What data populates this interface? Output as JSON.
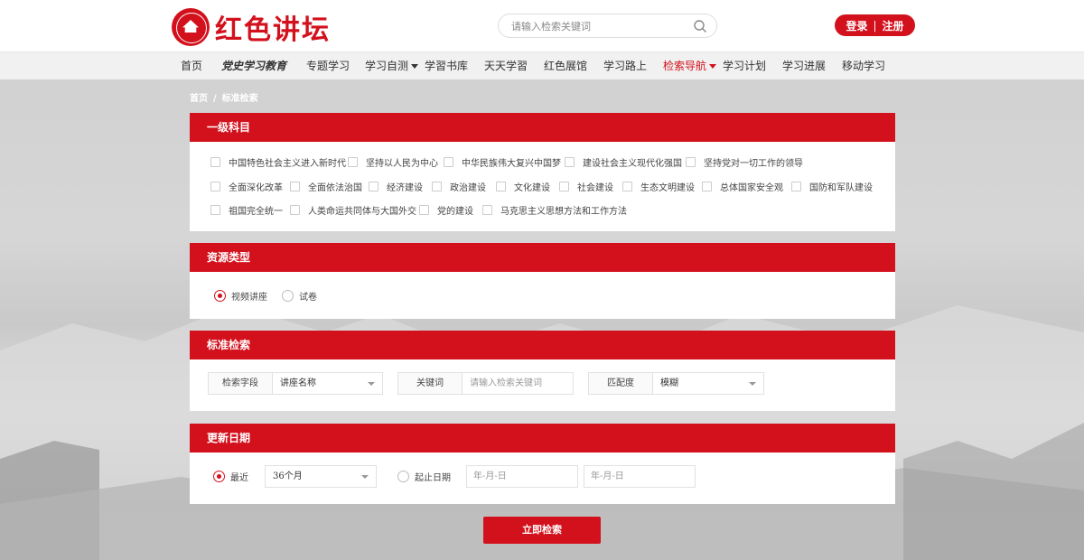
{
  "brand": {
    "name": "红色讲坛",
    "seal_icon": "party-history-seal-icon",
    "color": "#d3111d"
  },
  "search": {
    "placeholder": "请输入检索关键词",
    "icon": "search-icon"
  },
  "auth": {
    "login": "登录",
    "separator": "|",
    "register": "注册"
  },
  "nav": {
    "items": [
      {
        "label": "首页"
      },
      {
        "label": "党史学习教育"
      },
      {
        "label": "专题学习"
      },
      {
        "label": "学习自测",
        "dropdown": true
      },
      {
        "label": "学習书库"
      },
      {
        "label": "天天学習"
      },
      {
        "label": "红色展馆"
      },
      {
        "label": "学习路上"
      },
      {
        "label": "检索导航",
        "dropdown": true,
        "active": true
      },
      {
        "label": "学习计划"
      },
      {
        "label": "学习进展"
      },
      {
        "label": "移动学习"
      }
    ]
  },
  "breadcrumb": {
    "home": "首页",
    "separator": "/",
    "current": "标准检索"
  },
  "subjects": {
    "title": "一级科目",
    "rows": [
      [
        "中国特色社会主义进入新时代",
        "坚持以人民为中心",
        "中华民族伟大复兴中国梦",
        "建设社会主义现代化强国",
        "坚持党对一切工作的领导"
      ],
      [
        "全面深化改革",
        "全面依法治国",
        "经济建设",
        "政治建设",
        "文化建设",
        "社会建设",
        "生态文明建设",
        "总体国家安全观",
        "国防和军队建设"
      ],
      [
        "祖国完全统一",
        "人类命运共同体与大国外交",
        "党的建设",
        "马克思主义思想方法和工作方法"
      ]
    ]
  },
  "resource": {
    "title": "资源类型",
    "options": [
      {
        "label": "视频讲座",
        "selected": true
      },
      {
        "label": "试卷",
        "selected": false
      }
    ]
  },
  "standard": {
    "title": "标准检索",
    "field_label": "检索字段",
    "field_value": "讲座名称",
    "keyword_label": "关键词",
    "keyword_placeholder": "请输入检索关键词",
    "match_label": "匹配度",
    "match_value": "模糊"
  },
  "update": {
    "title": "更新日期",
    "recent_label": "最近",
    "recent_value": "36个月",
    "range_label": "起止日期",
    "start_placeholder": "年-月-日",
    "end_placeholder": "年-月-日"
  },
  "submit_label": "立即检索"
}
